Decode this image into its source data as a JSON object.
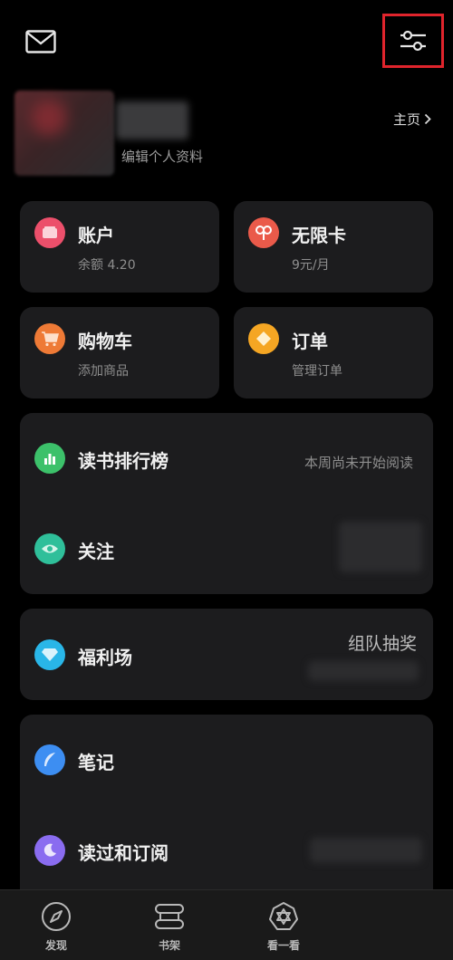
{
  "profile": {
    "edit_label": "编辑个人资料",
    "homepage_label": "主页"
  },
  "tiles": [
    {
      "title": "账户",
      "subtitle": "余额 4.20",
      "icon": "wallet-icon",
      "color": "#ec4f6b"
    },
    {
      "title": "无限卡",
      "subtitle": "9元/月",
      "icon": "infinity-card-icon",
      "color": "#ea5a4a"
    },
    {
      "title": "购物车",
      "subtitle": "添加商品",
      "icon": "cart-icon",
      "color": "#ee7a36"
    },
    {
      "title": "订单",
      "subtitle": "管理订单",
      "icon": "order-icon",
      "color": "#f5a623"
    }
  ],
  "list_group_1": [
    {
      "title": "读书排行榜",
      "right": "本周尚未开始阅读",
      "icon": "bar-chart-icon",
      "color": "#3cc16a"
    },
    {
      "title": "关注",
      "right": "",
      "icon": "eye-icon",
      "color": "#2fbf9a"
    }
  ],
  "welfare": {
    "title": "福利场",
    "right": "组队抽奖",
    "icon": "diamond-icon",
    "color": "#29b6e8"
  },
  "list_group_2": [
    {
      "title": "笔记",
      "icon": "feather-icon",
      "color": "#3d8ef2"
    },
    {
      "title": "读过和订阅",
      "icon": "moon-icon",
      "color": "#8a6cf0"
    }
  ],
  "bottom_nav": [
    {
      "label": "发现",
      "icon": "compass-icon"
    },
    {
      "label": "书架",
      "icon": "bookshelf-icon"
    },
    {
      "label": "看一看",
      "icon": "look-icon"
    }
  ],
  "colors": {
    "highlight": "#e0242c",
    "card": "#1c1c1e",
    "background": "#000000"
  }
}
